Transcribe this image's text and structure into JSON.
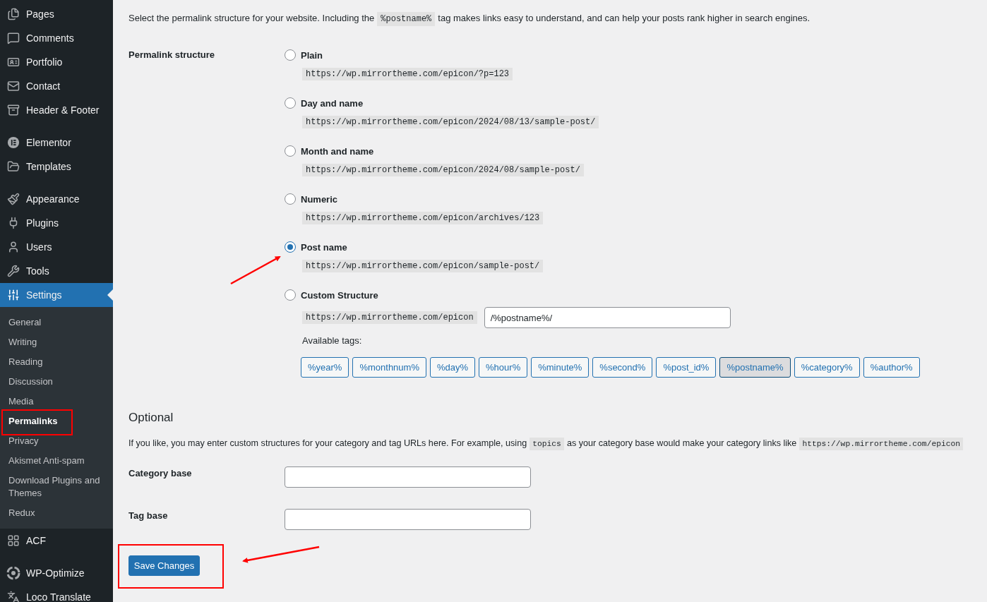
{
  "sidebar": {
    "groups": [
      {
        "items": [
          {
            "label": "Pages",
            "selected": false
          },
          {
            "label": "Comments",
            "selected": false
          },
          {
            "label": "Portfolio",
            "selected": false
          },
          {
            "label": "Contact",
            "selected": false
          },
          {
            "label": "Header & Footer",
            "selected": false
          }
        ]
      },
      {
        "items": [
          {
            "label": "Elementor",
            "selected": false
          },
          {
            "label": "Templates",
            "selected": false
          }
        ]
      },
      {
        "items": [
          {
            "label": "Appearance",
            "selected": false
          },
          {
            "label": "Plugins",
            "selected": false
          },
          {
            "label": "Users",
            "selected": false
          },
          {
            "label": "Tools",
            "selected": false
          },
          {
            "label": "Settings",
            "selected": true,
            "children": [
              {
                "label": "General",
                "selected": false
              },
              {
                "label": "Writing",
                "selected": false
              },
              {
                "label": "Reading",
                "selected": false
              },
              {
                "label": "Discussion",
                "selected": false
              },
              {
                "label": "Media",
                "selected": false
              },
              {
                "label": "Permalinks",
                "selected": true
              },
              {
                "label": "Privacy",
                "selected": false
              },
              {
                "label": "Akismet Anti-spam",
                "selected": false
              },
              {
                "label": "Download Plugins and Themes",
                "selected": false
              },
              {
                "label": "Redux",
                "selected": false
              }
            ]
          },
          {
            "label": "ACF",
            "selected": false
          }
        ]
      },
      {
        "items": [
          {
            "label": "WP-Optimize",
            "selected": false
          },
          {
            "label": "Loco Translate",
            "selected": false
          }
        ]
      }
    ]
  },
  "intro": {
    "before": "Select the permalink structure for your website. Including the",
    "code": "%postname%",
    "after": "tag makes links easy to understand, and can help your posts rank higher in search engines."
  },
  "permalink_structure": {
    "label": "Permalink structure",
    "options": [
      {
        "label": "Plain",
        "example": "https://wp.mirrortheme.com/epicon/?p=123",
        "selected": false
      },
      {
        "label": "Day and name",
        "example": "https://wp.mirrortheme.com/epicon/2024/08/13/sample-post/",
        "selected": false
      },
      {
        "label": "Month and name",
        "example": "https://wp.mirrortheme.com/epicon/2024/08/sample-post/",
        "selected": false
      },
      {
        "label": "Numeric",
        "example": "https://wp.mirrortheme.com/epicon/archives/123",
        "selected": false
      },
      {
        "label": "Post name",
        "example": "https://wp.mirrortheme.com/epicon/sample-post/",
        "selected": true
      }
    ],
    "custom": {
      "label": "Custom Structure",
      "selected": false,
      "prefix": "https://wp.mirrortheme.com/epicon",
      "value": "/%postname%/"
    },
    "available_tags_label": "Available tags:",
    "tags": [
      {
        "label": "%year%",
        "selected": false
      },
      {
        "label": "%monthnum%",
        "selected": false
      },
      {
        "label": "%day%",
        "selected": false
      },
      {
        "label": "%hour%",
        "selected": false
      },
      {
        "label": "%minute%",
        "selected": false
      },
      {
        "label": "%second%",
        "selected": false
      },
      {
        "label": "%post_id%",
        "selected": false
      },
      {
        "label": "%postname%",
        "selected": true
      },
      {
        "label": "%category%",
        "selected": false
      },
      {
        "label": "%author%",
        "selected": false
      }
    ]
  },
  "optional": {
    "heading": "Optional",
    "description": {
      "before": "If you like, you may enter custom structures for your category and tag URLs here. For example, using",
      "code": "topics",
      "middle": "as your category base would make your category links like",
      "code2": "https://wp.mirrortheme.com/epicon"
    },
    "fields": [
      {
        "label": "Category base"
      },
      {
        "label": "Tag base"
      }
    ]
  },
  "save_button": "Save Changes"
}
